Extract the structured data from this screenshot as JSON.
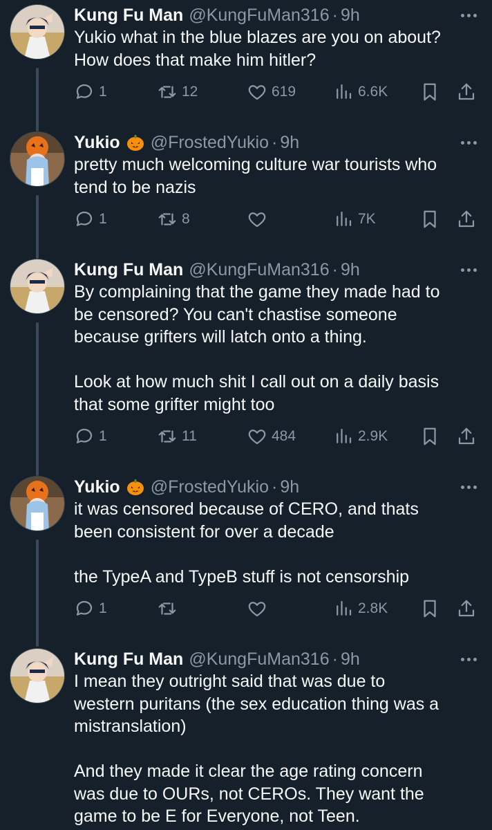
{
  "tweets": [
    {
      "name": "Kung Fu Man",
      "handle": "@KungFuMan316",
      "sep": "·",
      "time": "9h",
      "has_emoji": false,
      "text": "Yukio what in the blue blazes are you on about?\nHow does that make him hitler?",
      "replies": "1",
      "retweets": "12",
      "likes": "619",
      "views": "6.6K"
    },
    {
      "name": "Yukio",
      "handle": "@FrostedYukio",
      "sep": "·",
      "time": "9h",
      "has_emoji": true,
      "emoji_icon": "jack-o-lantern-icon",
      "text": "pretty much welcoming culture war tourists who\ntend to be nazis",
      "replies": "1",
      "retweets": "8",
      "likes": "",
      "views": "7K"
    },
    {
      "name": "Kung Fu Man",
      "handle": "@KungFuMan316",
      "sep": "·",
      "time": "9h",
      "has_emoji": false,
      "text": "By complaining that the game they made had to\nbe censored? You can't chastise someone\nbecause grifters will latch onto a thing.\n\nLook at how much shit I call out on a daily basis\nthat some grifter might too",
      "replies": "1",
      "retweets": "11",
      "likes": "484",
      "views": "2.9K"
    },
    {
      "name": "Yukio",
      "handle": "@FrostedYukio",
      "sep": "·",
      "time": "9h",
      "has_emoji": true,
      "emoji_icon": "jack-o-lantern-icon",
      "text": "it was censored because of CERO, and thats\nbeen consistent for over a decade\n\nthe TypeA and TypeB stuff is not censorship",
      "replies": "1",
      "retweets": "",
      "likes": "",
      "views": "2.8K"
    },
    {
      "name": "Kung Fu Man",
      "handle": "@KungFuMan316",
      "sep": "·",
      "time": "9h",
      "has_emoji": false,
      "text": "I mean they outright said that was due to\nwestern puritans (the sex education thing was a\nmistranslation)\n\nAnd they made it clear the age rating concern\nwas due to OURs, not CEROs. They want the\ngame to be E for Everyone, not Teen.",
      "replies": "",
      "retweets": "",
      "likes": "",
      "views": ""
    }
  ],
  "colors": {
    "background": "#15202b",
    "text": "#f7f9f9",
    "muted": "#8b98a5",
    "thread_line": "#3b4a57"
  }
}
